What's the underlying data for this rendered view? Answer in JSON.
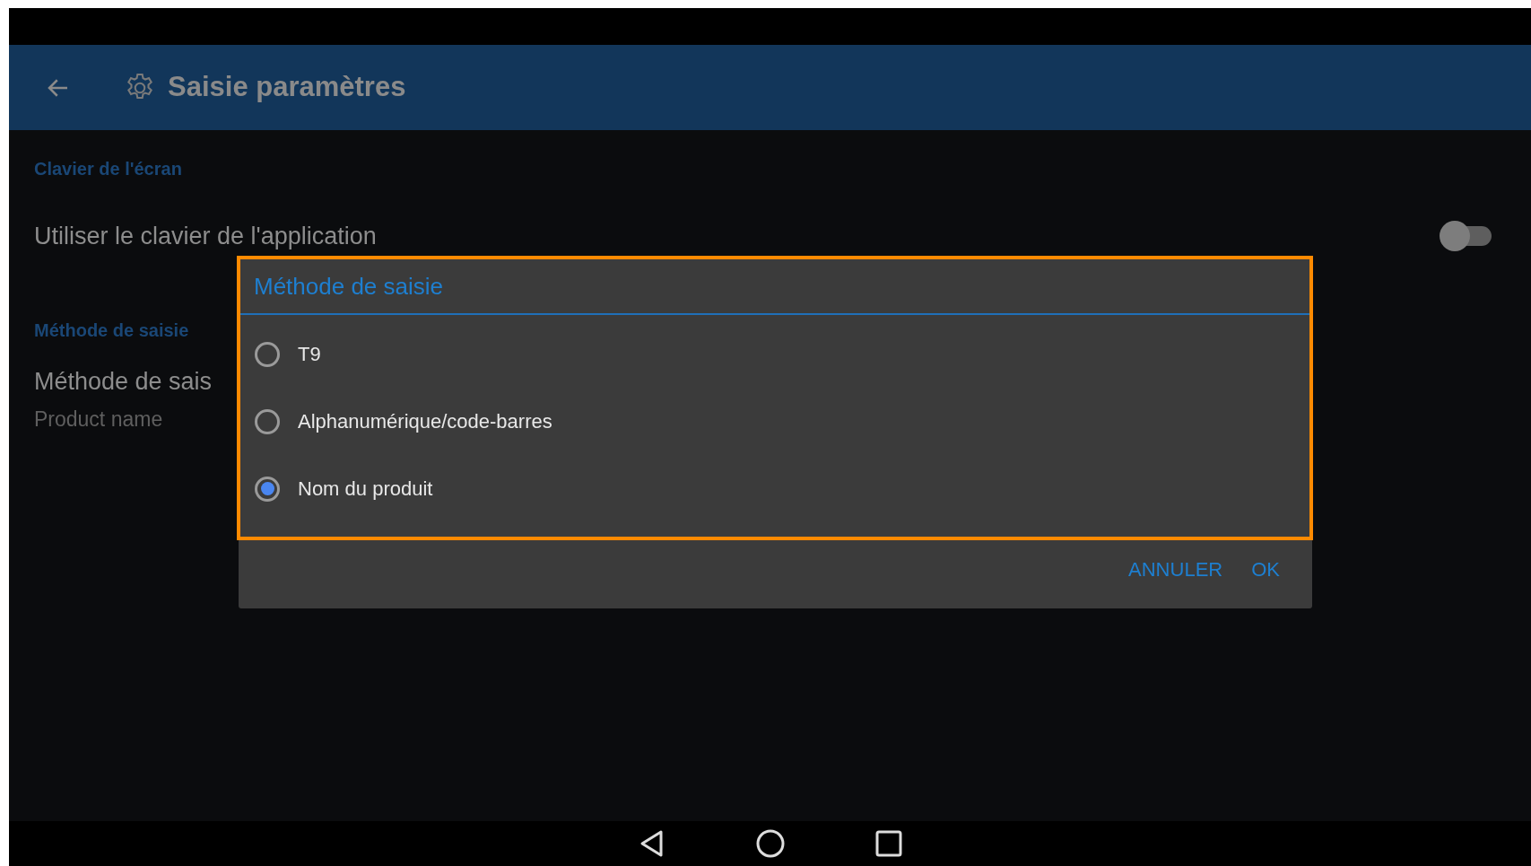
{
  "app_bar": {
    "title": "Saisie paramètres"
  },
  "sections": [
    {
      "header": "Clavier de l'écran",
      "items": [
        {
          "kind": "switch",
          "title": "Utiliser le clavier de l'application",
          "on": false
        }
      ]
    },
    {
      "header": "Méthode de saisie",
      "items": [
        {
          "kind": "value",
          "title": "Méthode de sais",
          "summary": "Product name"
        }
      ]
    }
  ],
  "dialog": {
    "title": "Méthode de saisie",
    "options": [
      {
        "label": "T9",
        "selected": false
      },
      {
        "label": "Alphanumérique/code-barres",
        "selected": false
      },
      {
        "label": "Nom du produit",
        "selected": true
      }
    ],
    "buttons": [
      "ANNULER",
      "OK"
    ]
  }
}
